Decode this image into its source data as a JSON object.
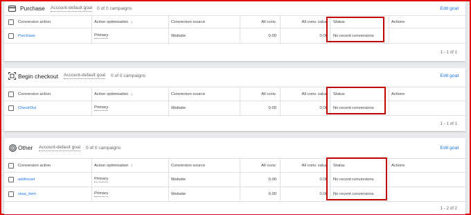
{
  "columns": {
    "action": "Conversion action",
    "optimisation": "Action optimisation",
    "source": "Conversion source",
    "all_conv": "All conv.",
    "all_conv_value": "All conv. value",
    "status": "Status",
    "actions": "Actions"
  },
  "sections": [
    {
      "icon": "credit-card-icon",
      "title": "Purchase",
      "goal": "Account-default goal",
      "campaigns": "0 of 0 campaigns",
      "edit": "Edit goal",
      "rows": [
        {
          "name": "Purchase",
          "optimisation": "Primary",
          "source": "Website",
          "all_conv": "0.00",
          "all_conv_value": "0.00",
          "status": "No recent conversions"
        }
      ],
      "pager": "1 - 1 of 1"
    },
    {
      "icon": "checkout-scan-icon",
      "title": "Begin checkout",
      "goal": "Account-default goal",
      "campaigns": "0 of 0 campaigns",
      "edit": "Edit goal",
      "rows": [
        {
          "name": "CheckOut",
          "optimisation": "Primary",
          "source": "Website",
          "all_conv": "0.00",
          "all_conv_value": "0.00",
          "status": "No recent conversions"
        }
      ],
      "pager": "1 - 1 of 1"
    },
    {
      "icon": "target-icon",
      "title": "Other",
      "goal": "Account-default goal",
      "campaigns": "0 of 0 campaigns",
      "edit": "Edit goal",
      "rows": [
        {
          "name": "addtocart",
          "optimisation": "Primary",
          "source": "Website",
          "all_conv": "0.00",
          "all_conv_value": "0.00",
          "status": "No recent conversions"
        },
        {
          "name": "view_item",
          "optimisation": "Primary",
          "source": "Website",
          "all_conv": "0.00",
          "all_conv_value": "0.00",
          "status": "No recent conversions"
        }
      ],
      "pager": "1 - 2 of 2"
    }
  ],
  "colors": {
    "link": "#1a73e8",
    "highlight": "#c00000",
    "frame": "#e00000"
  }
}
